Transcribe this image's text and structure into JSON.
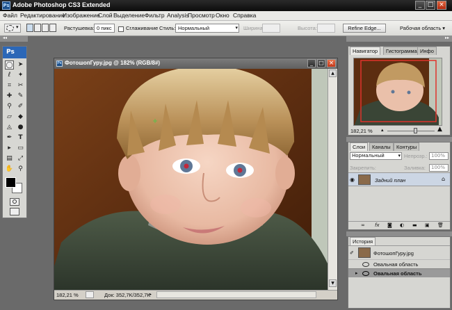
{
  "app": {
    "title": "Adobe Photoshop CS3 Extended"
  },
  "menu": [
    "Файл",
    "Редактирование",
    "Изображение",
    "Слой",
    "Выделение",
    "Фильтр",
    "Analysis",
    "Просмотр",
    "Окно",
    "Справка"
  ],
  "options": {
    "feather_label": "Растушевка:",
    "feather_value": "0 пикс",
    "antialias_label": "Сглаживание",
    "style_label": "Стиль:",
    "style_value": "Нормальный",
    "width_label": "Ширина:",
    "height_label": "Высота:",
    "refine_label": "Refine Edge...",
    "workspace_label": "Рабочая область ▾"
  },
  "toolbox": {
    "logo": "Ps"
  },
  "document": {
    "title": "ФотошопГуру.jpg @ 182% (RGB/8#)",
    "zoom": "182,21 %",
    "doc_info": "Док: 352,7K/352,7K"
  },
  "navigator": {
    "tabs": [
      "Навигатор",
      "Гистограмма",
      "Инфо"
    ],
    "zoom": "182,21 %"
  },
  "layers": {
    "tabs": [
      "Слои",
      "Каналы",
      "Контуры"
    ],
    "blend_mode": "Нормальный",
    "opacity_label": "Непрозр.:",
    "opacity_value": "100%",
    "lock_label": "Закрепить:",
    "fill_label": "Заливка:",
    "fill_value": "100%",
    "layer_name": "Задний план"
  },
  "history": {
    "tab": "История",
    "snapshot": "ФотошопГуру.jpg",
    "items": [
      "Овальная область",
      "Овальная область"
    ]
  },
  "colors": {
    "accent": "#2b67b7",
    "red_close": "#d9421f",
    "nav_frame": "#e0332a"
  }
}
